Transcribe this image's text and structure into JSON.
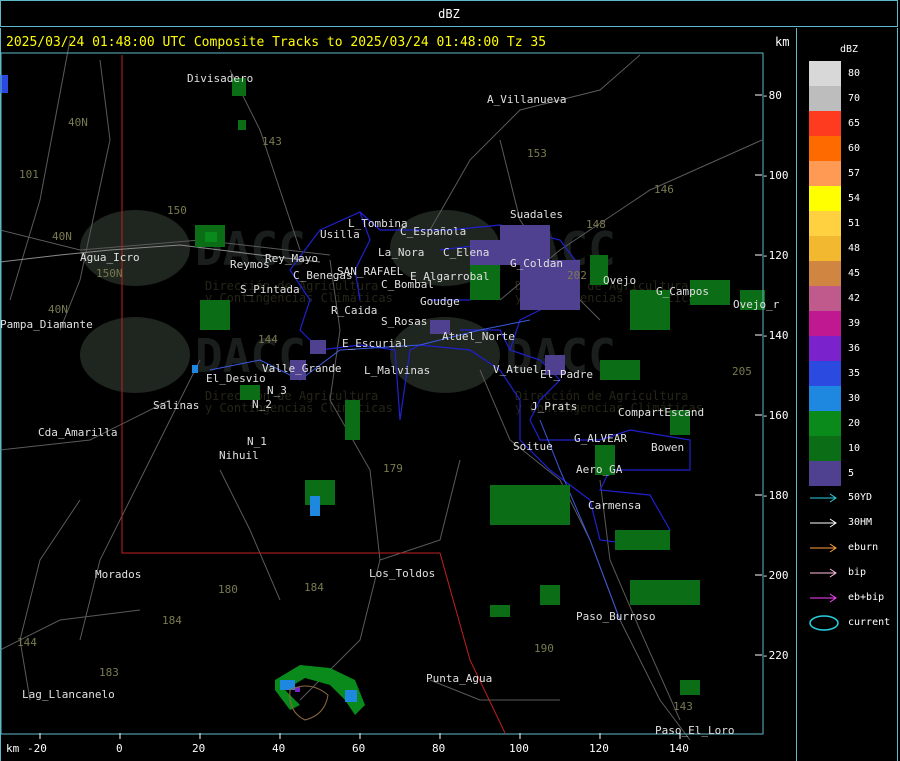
{
  "header": {
    "title": "dBZ"
  },
  "headline": "2025/03/24 01:48:00 UTC Composite Tracks to 2025/03/24 01:48:00 Tz 35",
  "units": {
    "right": "km",
    "bottom": "km"
  },
  "axes": {
    "x_ticks": [
      "-20",
      "0",
      "20",
      "40",
      "60",
      "80",
      "100",
      "120",
      "140"
    ],
    "y_ticks": [
      "-80",
      "-100",
      "-120",
      "-140",
      "-160",
      "-180",
      "-200",
      "-220"
    ]
  },
  "places": [
    "Divisadero",
    "A_Villanueva",
    "Usilla",
    "L_Tombina",
    "C_Española",
    "La_Nora",
    "C_Elena",
    "Suadales",
    "Agua_Icro",
    "Rey_Mayo",
    "Reymos",
    "S_Pintada",
    "C_Benegas",
    "SAN_RAFAEL",
    "C_Bombal",
    "E_Algarrobal",
    "G_Coldan",
    "Goudge",
    "R_Caida",
    "S_Rosas",
    "Atuel_Norte",
    "E_Escurial",
    "L_Malvinas",
    "V_Atuel",
    "El_Desvio",
    "Valle_Grande",
    "N_3",
    "N_2",
    "N_1",
    "Salinas",
    "Nihuil",
    "Cda_Amarilla",
    "El_Padre",
    "J_Prats",
    "CompartEscand",
    "G_ALVEAR",
    "Soitue",
    "Bowen",
    "Aero_GA",
    "Carmensa",
    "Ovejo",
    "G_Campos",
    "Pampa_Diamante",
    "Morados",
    "Los_Toldos",
    "Paso_Burroso",
    "Punta_Agua",
    "Lag_Llancanelo",
    "Paso_El_Loro",
    "Ovejo_r"
  ],
  "route_numbers": [
    "40N",
    "40N",
    "143",
    "153",
    "146",
    "101",
    "150",
    "148",
    "202",
    "144",
    "150N",
    "184",
    "184",
    "180",
    "179",
    "190",
    "183",
    "143",
    "144",
    "40N",
    "205"
  ],
  "legend": {
    "title": "dBZ",
    "items": [
      {
        "label": "80",
        "color": "#d8d8d8"
      },
      {
        "label": "70",
        "color": "#bdbdbd"
      },
      {
        "label": "65",
        "color": "#ff3b1f"
      },
      {
        "label": "60",
        "color": "#ff6a00"
      },
      {
        "label": "57",
        "color": "#ff9a55"
      },
      {
        "label": "54",
        "color": "#ffff00"
      },
      {
        "label": "51",
        "color": "#ffd040"
      },
      {
        "label": "48",
        "color": "#f2b830"
      },
      {
        "label": "45",
        "color": "#d08540"
      },
      {
        "label": "42",
        "color": "#c05a8c"
      },
      {
        "label": "39",
        "color": "#c01890"
      },
      {
        "label": "36",
        "color": "#7a22cc"
      },
      {
        "label": "35",
        "color": "#2a4ae0"
      },
      {
        "label": "30",
        "color": "#1e88e0"
      },
      {
        "label": "20",
        "color": "#0a8a1a"
      },
      {
        "label": "10",
        "color": "#0b6d16"
      },
      {
        "label": "5",
        "color": "#504090"
      }
    ],
    "tracks": [
      {
        "label": "50YD",
        "color": "#2ad0e0"
      },
      {
        "label": "30HM",
        "color": "#ffffff"
      },
      {
        "label": "eburn",
        "color": "#ffa040"
      },
      {
        "label": "bip",
        "color": "#ffc0e0"
      },
      {
        "label": "eb+bip",
        "color": "#ff40ff"
      },
      {
        "label": "current",
        "color": "#2ad0e0"
      }
    ]
  },
  "watermark": {
    "brand": "DACC",
    "line1": "Dirección de Agricultura",
    "line2": "y Contingencias Climáticas"
  }
}
